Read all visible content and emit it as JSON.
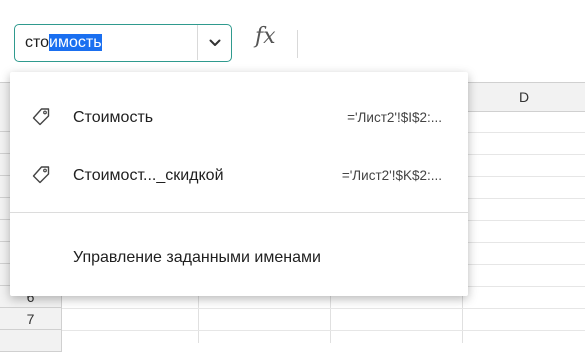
{
  "name_box": {
    "text_plain": "сто",
    "text_selected": "имость"
  },
  "formula_bar": {
    "fx_label": "fx"
  },
  "grid": {
    "visible_column_header": "D",
    "visible_row_headers": [
      "6",
      "7"
    ]
  },
  "name_dropdown": {
    "items": [
      {
        "name": "Стоимость",
        "ref": "='Лист2'!$I$2:...",
        "icon": "tag-icon"
      },
      {
        "name": "Стоимост..._скидкой",
        "ref": "='Лист2'!$K$2:...",
        "icon": "tag-icon"
      }
    ],
    "manage_label": "Управление заданными именами"
  },
  "colors": {
    "accent": "#2f9a8e",
    "selection": "#1a6ff0"
  }
}
